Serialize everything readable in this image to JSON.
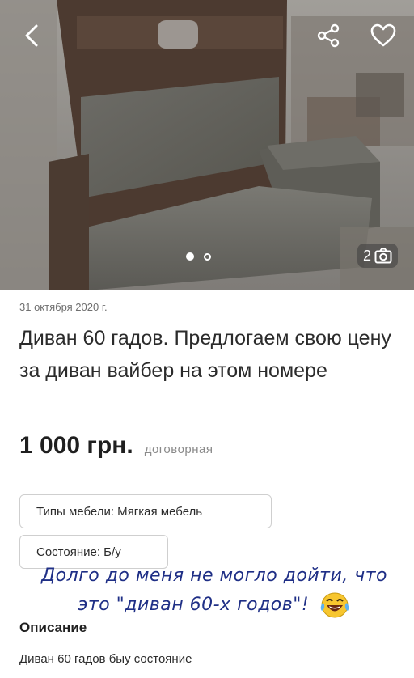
{
  "gallery": {
    "photo_alt": "Старий диван з сірою оббивкою",
    "counter_value": "2",
    "pages": 2,
    "active_page": 1
  },
  "listing": {
    "date": "31 октября 2020 г.",
    "title": "Диван 60 гадов. Предлогаем свою цену за диван вайбер на этом номере",
    "price": "1 000 грн.",
    "price_note": "договорная",
    "params": [
      "Типы мебели: Мягкая мебель",
      "Состояние: Б/у"
    ],
    "description_heading": "Описание",
    "description_text": "Диван 60 гадов быу состояние"
  },
  "overlay": {
    "caption": "Долго до меня не могло дойти, что это \"диван 60-х годов\"!",
    "emoji": "laughing-with-tears"
  },
  "colors": {
    "caption": "#1f2f86",
    "accent_text": "#1f1f1f"
  }
}
